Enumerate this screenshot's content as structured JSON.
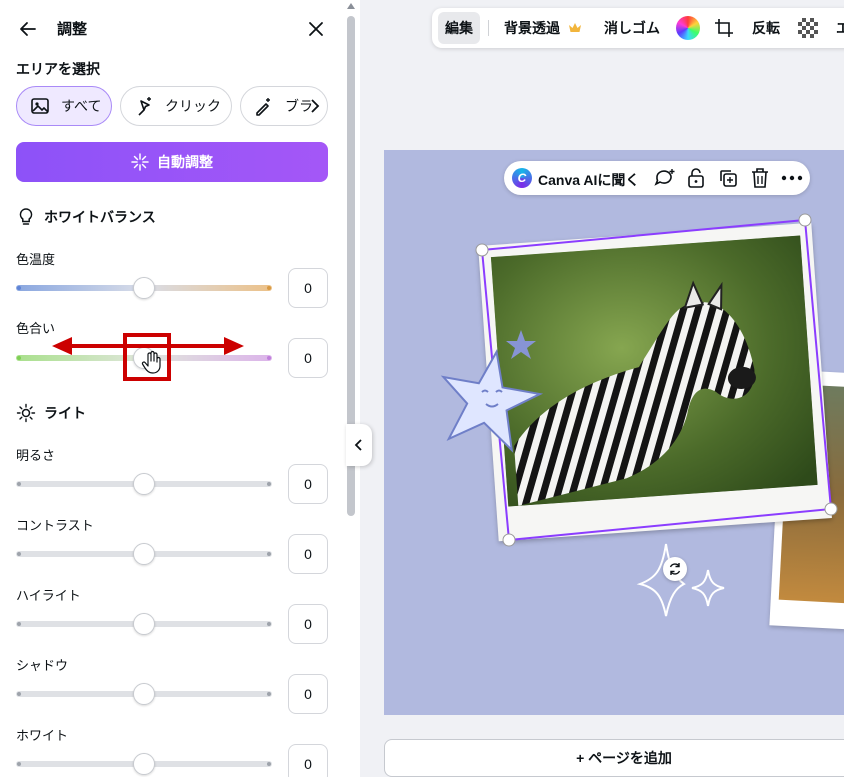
{
  "panel": {
    "title": "調整",
    "area_section": "エリアを選択",
    "chips": [
      {
        "label": "すべて",
        "icon": "image-icon",
        "active": true
      },
      {
        "label": "クリック",
        "icon": "magic-click-icon",
        "active": false
      },
      {
        "label": "ブラ",
        "icon": "magic-brush-icon",
        "active": false
      }
    ],
    "auto_adjust": "自動調整",
    "white_balance": {
      "title": "ホワイトバランス",
      "icon": "lightbulb-icon",
      "sliders": [
        {
          "label": "色温度",
          "value": "0"
        },
        {
          "label": "色合い",
          "value": "0"
        }
      ]
    },
    "light": {
      "title": "ライト",
      "icon": "sun-icon",
      "sliders": [
        {
          "label": "明るさ",
          "value": "0"
        },
        {
          "label": "コントラスト",
          "value": "0"
        },
        {
          "label": "ハイライト",
          "value": "0"
        },
        {
          "label": "シャドウ",
          "value": "0"
        },
        {
          "label": "ホワイト",
          "value": "0"
        }
      ]
    }
  },
  "toolbar": {
    "edit": "編集",
    "bg_remove": "背景透過",
    "eraser": "消しゴム",
    "flip": "反転",
    "more": "エ"
  },
  "context_bar": {
    "ask_ai": "Canva AIに聞く",
    "logo_letter": "C"
  },
  "add_page": "+ ページを追加",
  "colors": {
    "accent": "#8d52f8",
    "canvas_bg": "#b1b9df",
    "annotation": "#cc0000"
  }
}
